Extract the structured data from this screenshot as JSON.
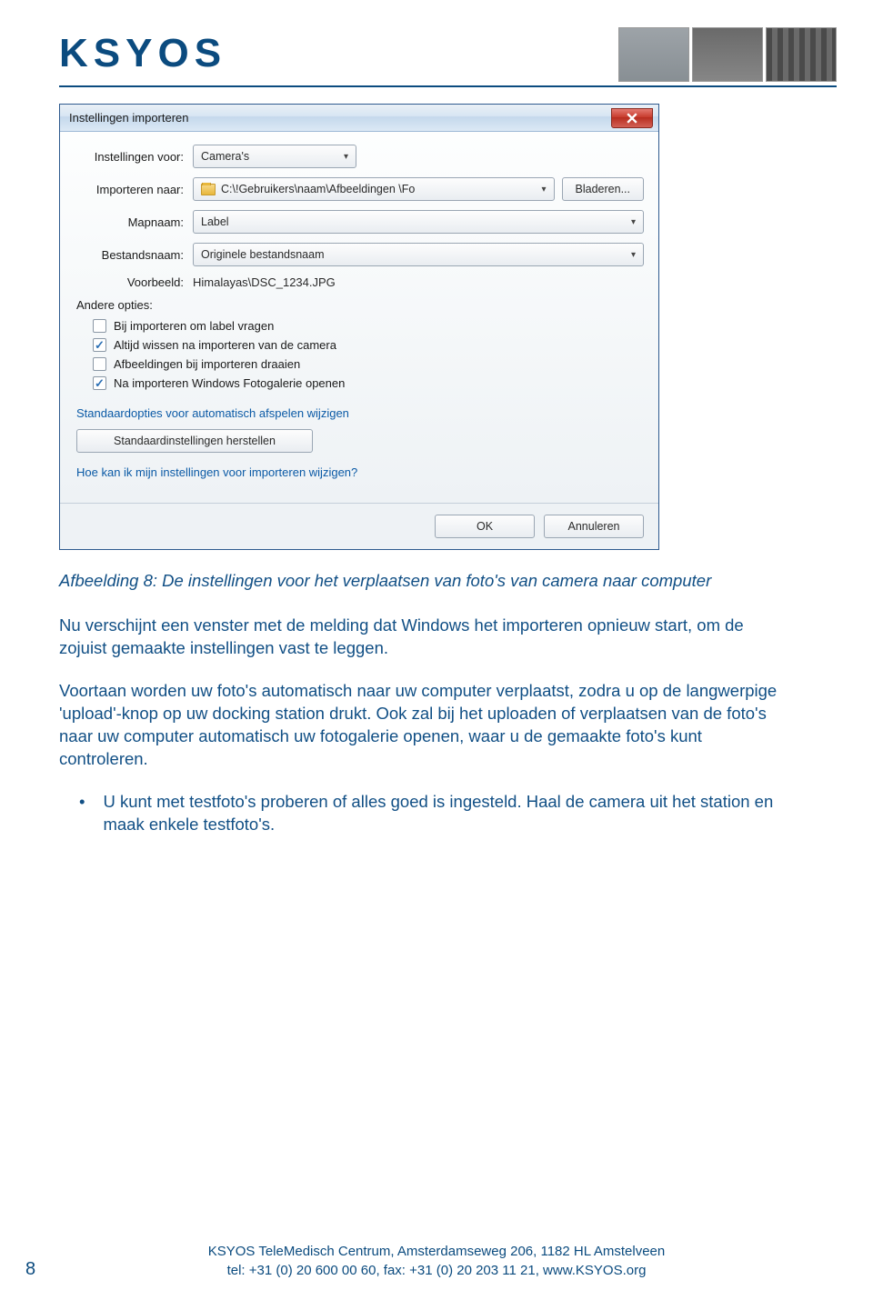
{
  "header": {
    "logo": "KSYOS"
  },
  "dialog": {
    "title": "Instellingen importeren",
    "fields": {
      "settings_for_label": "Instellingen voor:",
      "settings_for_value": "Camera's",
      "import_to_label": "Importeren naar:",
      "import_to_value": "C:\\!Gebruikers\\naam\\Afbeeldingen  \\Fo",
      "browse_label": "Bladeren...",
      "folder_name_label": "Mapnaam:",
      "folder_name_value": "Label",
      "file_name_label": "Bestandsnaam:",
      "file_name_value": "Originele bestandsnaam",
      "example_label": "Voorbeeld:",
      "example_value": "Himalayas\\DSC_1234.JPG"
    },
    "other_options_label": "Andere opties:",
    "checks": [
      {
        "label": "Bij importeren om label vragen",
        "checked": false
      },
      {
        "label": "Altijd wissen na importeren van de camera",
        "checked": true
      },
      {
        "label": "Afbeeldingen bij importeren draaien",
        "checked": false
      },
      {
        "label": "Na importeren Windows Fotogalerie openen",
        "checked": true
      }
    ],
    "link_auto": "Standaardopties voor automatisch afspelen wijzigen",
    "restore_label": "Standaardinstellingen herstellen",
    "link_help": "Hoe kan ik mijn instellingen voor importeren wijzigen?",
    "ok_label": "OK",
    "cancel_label": "Annuleren"
  },
  "doc": {
    "caption": "Afbeelding 8: De instellingen voor het verplaatsen van foto's van camera naar computer",
    "para1": "Nu verschijnt een venster met de melding dat Windows het importeren opnieuw start, om de zojuist gemaakte instellingen vast te leggen.",
    "para2": "Voortaan worden uw foto's automatisch naar uw computer verplaatst, zodra u op de langwerpige 'upload'-knop op uw docking station drukt. Ook zal bij het uploaden of verplaatsen van de foto's naar uw computer automatisch uw fotogalerie openen, waar u de gemaakte foto's kunt controleren.",
    "bullet": "U kunt met testfoto's proberen of alles goed is ingesteld. Haal de camera uit het station en maak enkele testfoto's."
  },
  "footer": {
    "line1": "KSYOS TeleMedisch Centrum, Amsterdamseweg 206, 1182 HL Amstelveen",
    "line2": "tel: +31 (0) 20 600 00 60, fax: +31 (0) 20 203 11 21, www.KSYOS.org",
    "page_num": "8"
  }
}
